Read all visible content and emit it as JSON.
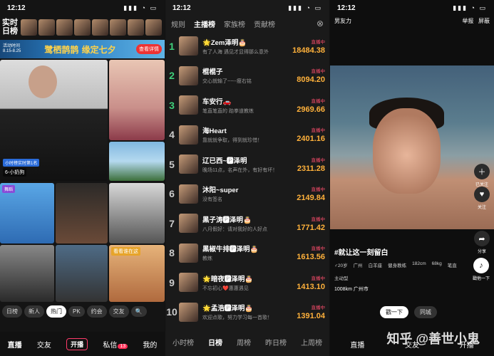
{
  "p1": {
    "time": "12:12",
    "title": "实时日榜",
    "banner": {
      "left": "活动时间 8.15-8.25",
      "title": "鹭栖鹊鹊 缘定七夕",
      "btn": "查看详情"
    },
    "tags": {
      "t1": "小时榜实时第1名",
      "t1b": "6-小奶狗",
      "kmk": "看看谁在这",
      "dance": "舞蹈"
    },
    "cats": [
      "日榜",
      "新人",
      "热门",
      "PK",
      "约会",
      "交友"
    ],
    "nav": {
      "live": "直播",
      "social": "交友",
      "open": "开播",
      "msg": "私信",
      "badge": "13",
      "me": "我的"
    }
  },
  "p2": {
    "time": "12:12",
    "rules": "规则",
    "tabs": [
      "主播榜",
      "家族榜",
      "贡献榜"
    ],
    "rows": [
      {
        "rank": "1",
        "name": "🌟Zem泽明🎂",
        "sub": "有了人海 遇见才显得那么意外",
        "status": "直播中",
        "val": "18484.38"
      },
      {
        "rank": "2",
        "name": "棍棍子",
        "sub": "交心就输了~~--瘦右铭",
        "status": "直播中",
        "val": "8094.20"
      },
      {
        "rank": "3",
        "name": "车安行🚗",
        "sub": "笔直笔直的 跆拳道教练",
        "status": "直播中",
        "val": "2969.66"
      },
      {
        "rank": "4",
        "name": "海Heart",
        "sub": "靠就就争取，得到就珍惜！",
        "status": "直播中",
        "val": "2401.16"
      },
      {
        "rank": "5",
        "name": "辽已西~🅿泽明",
        "sub": "晚场11点，名声在外，有好有坏！",
        "status": "直播中",
        "val": "2311.28"
      },
      {
        "rank": "6",
        "name": "沐阳~super",
        "sub": "没有签名",
        "status": "直播中",
        "val": "2149.84"
      },
      {
        "rank": "7",
        "name": "黑子涛🅿泽明🎂",
        "sub": "八月假好：请对我好的人好点",
        "status": "直播中",
        "val": "1771.42"
      },
      {
        "rank": "8",
        "name": "黑椒牛排🅿泽明🎂",
        "sub": "教练",
        "status": "直播中",
        "val": "1613.56"
      },
      {
        "rank": "9",
        "name": "🌟暗夜🅿泽明🎂",
        "sub": "不忘初心❤️惠惠遇见",
        "status": "直播中",
        "val": "1413.10"
      },
      {
        "rank": "10",
        "name": "🌟孟浩🅿泽明🎂",
        "sub": "欢迎点歌，努力学习每一首歌！",
        "status": "直播中",
        "val": "1391.04"
      }
    ],
    "nav": [
      "小时榜",
      "日榜",
      "周榜",
      "昨日榜",
      "上周榜"
    ]
  },
  "p3": {
    "time": "12:12",
    "brand": "男友力",
    "report": "举报",
    "block": "屏蔽",
    "line": "#就让这一刻留白",
    "info": [
      "♂20岁",
      "广州",
      "白羊座",
      "健身教练",
      "182cm",
      "68kg",
      "笔直",
      "主动型"
    ],
    "loc": "1008km 广州市",
    "side": {
      "follow": "关注",
      "tag": "已关注",
      "share": "分享",
      "dance": "戳他一下"
    },
    "btn1": "戳一下",
    "btn2": "同城",
    "nav": [
      "直播",
      "交友",
      "开播"
    ],
    "watermark": "知乎 @善世小鬼"
  }
}
